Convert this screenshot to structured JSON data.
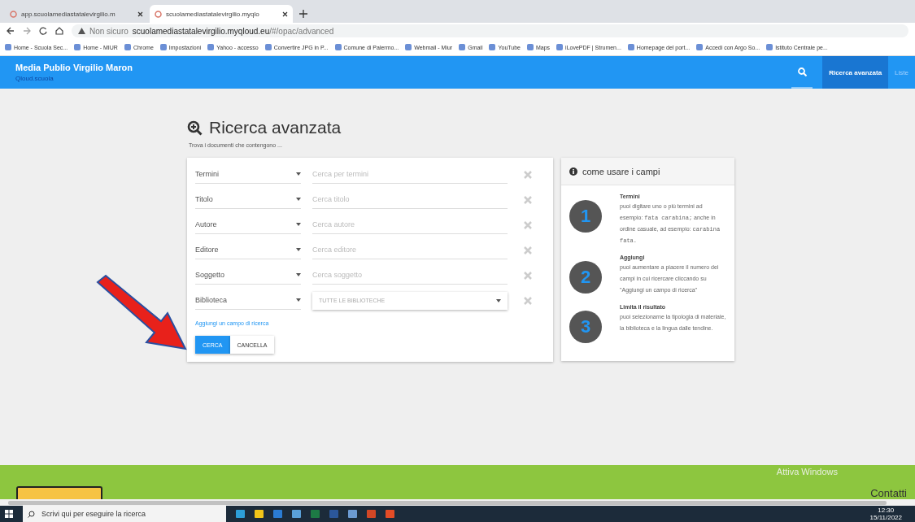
{
  "browser": {
    "tabs": [
      {
        "title": "app.scuolamediastatalevirgilio.m",
        "selected": false
      },
      {
        "title": "scuolamediastatalevirgilio.myqlo",
        "selected": true
      }
    ],
    "security": "Non sicuro",
    "url_host": "scuolamediastatalevirgilio.myqloud.eu",
    "url_path": "/#/opac/advanced",
    "bookmarks": [
      "Home - Scuola Sec...",
      "Home - MIUR",
      "Chrome",
      "Impostazioni",
      "Yahoo - accesso",
      "Convertire JPG in P...",
      "Comune di Palermo...",
      "Webmail - Miur",
      "Gmail",
      "YouTube",
      "Maps",
      "iLovePDF | Strumen...",
      "Homepage del port...",
      "Accedi con Argo So...",
      "Istituto Centrale pe..."
    ]
  },
  "header": {
    "title": "Media Publio Virgilio Maron",
    "subtitle": "Qloud.scuola",
    "nav": [
      {
        "label": "Ricerca avanzata",
        "selected": true
      },
      {
        "label": "Liste",
        "selected": false
      }
    ]
  },
  "page": {
    "title": "Ricerca avanzata",
    "subtitle": "Trova i documenti che contengono ...",
    "rows": [
      {
        "field": "Termini",
        "kind": "input",
        "placeholder": "Cerca per termini"
      },
      {
        "field": "Titolo",
        "kind": "input",
        "placeholder": "Cerca titolo"
      },
      {
        "field": "Autore",
        "kind": "input",
        "placeholder": "Cerca autore"
      },
      {
        "field": "Editore",
        "kind": "input",
        "placeholder": "Cerca editore"
      },
      {
        "field": "Soggetto",
        "kind": "input",
        "placeholder": "Cerca soggetto"
      },
      {
        "field": "Biblioteca",
        "kind": "select",
        "value": "TUTTE LE BIBLIOTECHE"
      }
    ],
    "add_link": "Aggiungi un campo di ricerca",
    "buttons": [
      {
        "label": "CERCA",
        "kind": "primary"
      },
      {
        "label": "CANCELLA",
        "kind": "secondary"
      }
    ],
    "help": {
      "title": "come usare i campi",
      "items": [
        {
          "number": "1",
          "title": "Termini",
          "body": [
            {
              "kind": "text",
              "text": "puoi digitare uno o più termini ad esempio: "
            },
            {
              "kind": "code",
              "text": "fata carabina;"
            },
            {
              "kind": "text",
              "text": " anche in ordine casuale, ad esempio: "
            },
            {
              "kind": "code",
              "text": "carabina fata."
            }
          ]
        },
        {
          "number": "2",
          "title": "Aggiungi",
          "body": [
            {
              "kind": "text",
              "text": "puoi aumentare a piacere il numero dei campi in cui ricercare cliccando su \"Aggiungi un campo di ricerca\""
            }
          ]
        },
        {
          "number": "3",
          "title": "Limita il risultato",
          "body": [
            {
              "kind": "text",
              "text": "puoi selezionarne la tipologia di materiale, la biblioteca e la lingua dalle tendine."
            }
          ]
        }
      ]
    }
  },
  "footer": {
    "link": "Contatti",
    "notice": "Attiva Windows"
  },
  "taskbar": {
    "search_placeholder": "Scrivi qui per eseguire la ricerca",
    "time": "12:30",
    "date": "15/11/2022"
  }
}
